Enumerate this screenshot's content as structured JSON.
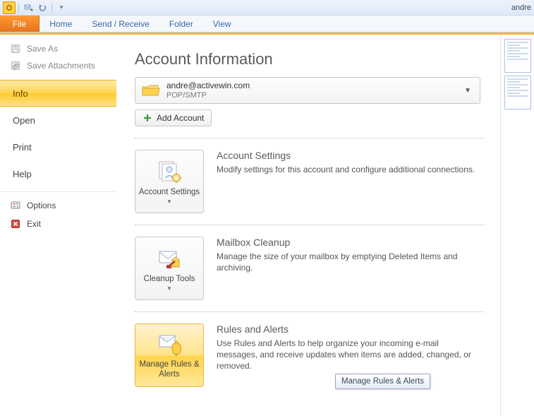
{
  "titlebar": {
    "caption": "andre"
  },
  "ribbon": {
    "file": "File",
    "tabs": [
      "Home",
      "Send / Receive",
      "Folder",
      "View"
    ]
  },
  "left": {
    "save_as": "Save As",
    "save_attachments": "Save Attachments",
    "nav": [
      "Info",
      "Open",
      "Print",
      "Help"
    ],
    "selected_index": 0,
    "options": "Options",
    "exit": "Exit"
  },
  "main": {
    "heading": "Account Information",
    "account": {
      "email": "andre@activewin.com",
      "protocol": "POP/SMTP"
    },
    "add_account": "Add Account",
    "sections": [
      {
        "button_label": "Account Settings",
        "has_dropdown": true,
        "title": "Account Settings",
        "desc": "Modify settings for this account and configure additional connections."
      },
      {
        "button_label": "Cleanup Tools",
        "has_dropdown": true,
        "title": "Mailbox Cleanup",
        "desc": "Manage the size of your mailbox by emptying Deleted Items and archiving."
      },
      {
        "button_label": "Manage Rules & Alerts",
        "has_dropdown": false,
        "title": "Rules and Alerts",
        "desc": "Use Rules and Alerts to help organize your incoming e-mail messages, and receive updates when items are added, changed, or removed."
      }
    ],
    "tooltip": "Manage Rules & Alerts"
  }
}
